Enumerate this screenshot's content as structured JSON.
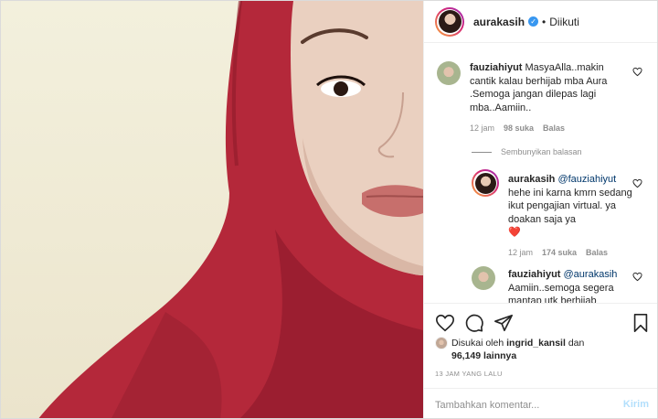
{
  "post": {
    "author": "aurakasih",
    "follow_status": "Diikuti",
    "separator": "•"
  },
  "comments": [
    {
      "user": "fauziahiyut",
      "text": "MasyaAlla..makin cantik kalau berhijab mba Aura .Semoga jangan dilepas lagi mba..Aamiin..",
      "time": "12 jam",
      "likes": "98 suka",
      "reply": "Balas"
    }
  ],
  "hide_replies_label": "Sembunyikan balasan",
  "replies": [
    {
      "user": "aurakasih",
      "mention": "@fauziahiyut",
      "text": "hehe ini karna kmrn sedang ikut pengajian virtual. ya doakan saja ya",
      "emoji": "❤️",
      "time": "12 jam",
      "likes": "174 suka",
      "reply": "Balas"
    },
    {
      "user": "fauziahiyut",
      "mention": "@aurakasih",
      "text": "Aamiin..semoga segera mantap utk berhijab"
    }
  ],
  "likes_line": {
    "prefix": "Disukai oleh",
    "user": "ingrid_kansil",
    "conj": "dan",
    "count": "96,149",
    "suffix": "lainnya"
  },
  "timestamp": "13 JAM YANG LALU",
  "comment_box": {
    "placeholder": "Tambahkan komentar...",
    "send_label": "Kirim"
  },
  "colors": {
    "link": "#00376b",
    "verified": "#3897f0",
    "send_disabled": "#b2dffc",
    "muted": "#8e8e8e",
    "hijab": "#b4283a"
  }
}
